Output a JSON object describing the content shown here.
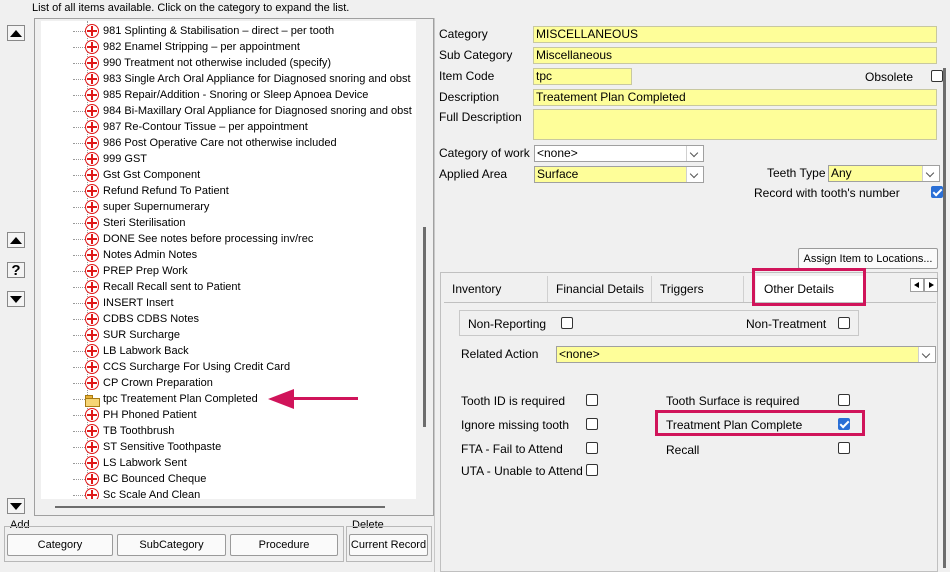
{
  "hint": "List of all items available. Click on the category to expand the list.",
  "tree": {
    "items": [
      {
        "label": "981 Splinting & Stabilisation  – direct  – per tooth",
        "icon": "cross"
      },
      {
        "label": "982 Enamel Stripping  – per appointment",
        "icon": "cross"
      },
      {
        "label": "990 Treatment not otherwise included (specify)",
        "icon": "cross"
      },
      {
        "label": "983 Single Arch Oral Appliance for Diagnosed snoring and obst",
        "icon": "cross"
      },
      {
        "label": "985 Repair/Addition - Snoring or Sleep Apnoea Device",
        "icon": "cross"
      },
      {
        "label": "984 Bi-Maxillary Oral Appliance for Diagnosed snoring and obst",
        "icon": "cross"
      },
      {
        "label": "987 Re-Contour Tissue  – per appointment",
        "icon": "cross"
      },
      {
        "label": "986 Post Operative Care not otherwise included",
        "icon": "cross"
      },
      {
        "label": "999 GST",
        "icon": "cross"
      },
      {
        "label": "Gst Gst Component",
        "icon": "cross"
      },
      {
        "label": "Refund Refund To Patient",
        "icon": "cross"
      },
      {
        "label": "super Supernumerary",
        "icon": "cross"
      },
      {
        "label": "Steri Sterilisation",
        "icon": "cross"
      },
      {
        "label": "DONE See notes before processing inv/rec",
        "icon": "cross"
      },
      {
        "label": "Notes Admin Notes",
        "icon": "cross"
      },
      {
        "label": "PREP Prep Work",
        "icon": "cross"
      },
      {
        "label": "Recall Recall sent to Patient",
        "icon": "cross"
      },
      {
        "label": "INSERT Insert",
        "icon": "cross"
      },
      {
        "label": "CDBS CDBS Notes",
        "icon": "cross"
      },
      {
        "label": "SUR Surcharge",
        "icon": "cross"
      },
      {
        "label": "LB Labwork Back",
        "icon": "cross"
      },
      {
        "label": "CCS Surcharge For Using Credit Card",
        "icon": "cross"
      },
      {
        "label": "CP Crown Preparation",
        "icon": "cross"
      },
      {
        "label": "tpc Treatement Plan Completed",
        "icon": "folder"
      },
      {
        "label": "PH Phoned Patient",
        "icon": "cross"
      },
      {
        "label": "TB Toothbrush",
        "icon": "cross"
      },
      {
        "label": "ST Sensitive Toothpaste",
        "icon": "cross"
      },
      {
        "label": "LS Labwork Sent",
        "icon": "cross"
      },
      {
        "label": "BC Bounced Cheque",
        "icon": "cross"
      },
      {
        "label": "Sc Scale And Clean",
        "icon": "cross"
      }
    ]
  },
  "add": {
    "label": "Add",
    "category": "Category",
    "subcategory": "SubCategory",
    "procedure": "Procedure"
  },
  "delete": {
    "label": "Delete",
    "current": "Current Record"
  },
  "form": {
    "category_label": "Category",
    "category_value": "MISCELLANEOUS",
    "subcategory_label": "Sub Category",
    "subcategory_value": "Miscellaneous",
    "itemcode_label": "Item Code",
    "itemcode_value": "tpc",
    "obsolete_label": "Obsolete",
    "description_label": "Description",
    "description_value": "Treatement Plan Completed",
    "fulldesc_label": "Full Description",
    "fulldesc_value": "",
    "catwork_label": "Category of work",
    "catwork_value": "<none>",
    "applied_label": "Applied Area",
    "applied_value": "Surface",
    "teethtype_label": "Teeth Type",
    "teethtype_value": "Any",
    "record_tooth_label": "Record with tooth's number",
    "assign_button": "Assign Item to Locations..."
  },
  "tabs": [
    "Inventory",
    "Financial Details",
    "Triggers",
    "Other Details"
  ],
  "other": {
    "nonreporting": "Non-Reporting",
    "nontreatment": "Non-Treatment",
    "related_label": "Related Action",
    "related_value": "<none>",
    "toothid": "Tooth ID is required",
    "ignore": "Ignore missing tooth",
    "fta": "FTA - Fail to Attend",
    "uta": "UTA - Unable to Attend",
    "surface": "Tooth Surface is required",
    "tpc": "Treatment Plan Complete",
    "recall": "Recall",
    "tpc_checked": true
  },
  "colors": {
    "accent": "#d0145a",
    "field_yellow": "#fefe99",
    "check_blue": "#2a6fd6",
    "cross_red": "#e01818"
  }
}
